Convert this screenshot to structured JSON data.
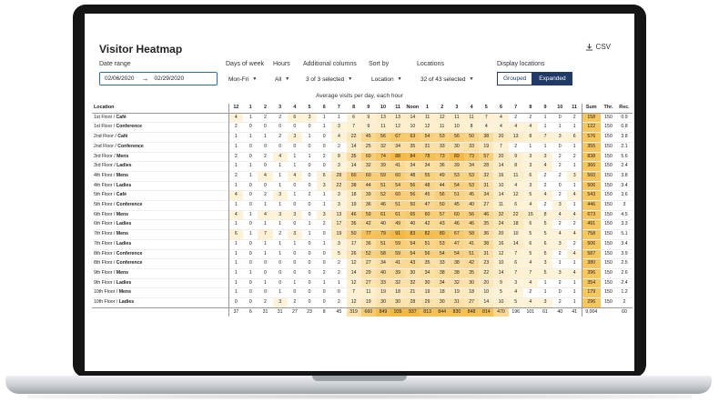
{
  "app": {
    "title": "Visitor Heatmap",
    "csv_label": "CSV"
  },
  "filters": {
    "date_range": {
      "label": "Date range",
      "start": "02/06/2020",
      "end": "02/29/2020"
    },
    "days_of_week": {
      "label": "Days of week",
      "value": "Mon-Fri"
    },
    "hours": {
      "label": "Hours",
      "value": "All"
    },
    "additional_columns": {
      "label": "Additional columns",
      "value": "3 of 3 selected"
    },
    "sort_by": {
      "label": "Sort by",
      "value": "Location"
    },
    "locations": {
      "label": "Locations",
      "value": "32 of 43 selected"
    },
    "display_locations": {
      "label": "Display locations",
      "grouped": "Grouped",
      "expanded": "Expanded",
      "active": "Expanded"
    }
  },
  "table": {
    "subtitle": "Average visits per day, each hour",
    "columns": [
      "Location",
      "12",
      "1",
      "2",
      "3",
      "4",
      "5",
      "6",
      "7",
      "8",
      "9",
      "10",
      "11",
      "Noon",
      "1",
      "2",
      "3",
      "4",
      "5",
      "6",
      "7",
      "8",
      "9",
      "10",
      "11",
      "Sum",
      "Thr.",
      "Rec."
    ],
    "rows": [
      {
        "location": "1st Floor / Café",
        "values": [
          4,
          1,
          2,
          2,
          6,
          3,
          1,
          1,
          6,
          9,
          13,
          13,
          14,
          11,
          12,
          11,
          11,
          7,
          4,
          2,
          2,
          1,
          0,
          2
        ],
        "sum": "158",
        "thr": "150",
        "rec": "0.9"
      },
      {
        "location": "1st Floor / Conference",
        "values": [
          2,
          0,
          0,
          0,
          0,
          0,
          1,
          3,
          7,
          9,
          11,
          12,
          10,
          12,
          11,
          10,
          8,
          4,
          4,
          4,
          4,
          1,
          1,
          1
        ],
        "sum": "122",
        "thr": "150",
        "rec": "0.8"
      },
      {
        "location": "2nd Floor / Café",
        "values": [
          1,
          1,
          1,
          2,
          3,
          1,
          0,
          4,
          22,
          45,
          56,
          67,
          63,
          54,
          53,
          56,
          50,
          38,
          20,
          13,
          8,
          7,
          3,
          6
        ],
        "sum": "576",
        "thr": "150",
        "rec": "3.8"
      },
      {
        "location": "2nd Floor / Conference",
        "values": [
          1,
          0,
          0,
          0,
          0,
          0,
          0,
          2,
          14,
          25,
          32,
          34,
          35,
          31,
          33,
          30,
          33,
          19,
          7,
          2,
          1,
          1,
          0,
          1
        ],
        "sum": "355",
        "thr": "150",
        "rec": "2.1"
      },
      {
        "location": "3rd Floor / Mens",
        "values": [
          2,
          0,
          2,
          4,
          1,
          1,
          2,
          8,
          35,
          60,
          74,
          88,
          84,
          78,
          73,
          89,
          73,
          57,
          20,
          9,
          3,
          3,
          2,
          2
        ],
        "sum": "838",
        "thr": "150",
        "rec": "5.6"
      },
      {
        "location": "3rd Floor / Ladies",
        "values": [
          1,
          1,
          0,
          1,
          1,
          0,
          0,
          3,
          14,
          32,
          39,
          41,
          34,
          34,
          36,
          39,
          34,
          28,
          14,
          8,
          3,
          4,
          2,
          1
        ],
        "sum": "366",
        "thr": "150",
        "rec": "2.4"
      },
      {
        "location": "4th Floor / Mens",
        "values": [
          2,
          1,
          4,
          1,
          4,
          0,
          6,
          28,
          60,
          60,
          59,
          60,
          48,
          55,
          49,
          53,
          53,
          32,
          16,
          11,
          6,
          2,
          2,
          3
        ],
        "sum": "560",
        "thr": "150",
        "rec": "3.8"
      },
      {
        "location": "4th Floor / Ladies",
        "values": [
          1,
          0,
          0,
          1,
          0,
          0,
          3,
          22,
          38,
          44,
          51,
          54,
          56,
          48,
          44,
          54,
          53,
          31,
          10,
          4,
          3,
          2,
          0,
          1
        ],
        "sum": "506",
        "thr": "150",
        "rec": "3.4"
      },
      {
        "location": "5th Floor / Café",
        "values": [
          4,
          0,
          2,
          3,
          1,
          2,
          1,
          3,
          18,
          39,
          52,
          60,
          56,
          45,
          56,
          51,
          45,
          34,
          14,
          12,
          5,
          4,
          2,
          4
        ],
        "sum": "543",
        "thr": "150",
        "rec": "3.6"
      },
      {
        "location": "5th Floor / Conference",
        "values": [
          1,
          0,
          1,
          1,
          0,
          0,
          1,
          3,
          19,
          36,
          46,
          51,
          50,
          47,
          50,
          45,
          40,
          27,
          11,
          6,
          4,
          2,
          3,
          1
        ],
        "sum": "446",
        "thr": "150",
        "rec": "3"
      },
      {
        "location": "6th Floor / Mens",
        "values": [
          4,
          1,
          4,
          3,
          3,
          0,
          3,
          13,
          46,
          59,
          61,
          61,
          65,
          60,
          57,
          60,
          56,
          46,
          32,
          22,
          15,
          8,
          4,
          4
        ],
        "sum": "673",
        "thr": "150",
        "rec": "4.5"
      },
      {
        "location": "6th Floor / Ladies",
        "values": [
          1,
          0,
          1,
          1,
          0,
          1,
          2,
          17,
          36,
          42,
          40,
          49,
          40,
          42,
          43,
          46,
          46,
          35,
          24,
          18,
          6,
          5,
          2,
          2
        ],
        "sum": "491",
        "thr": "150",
        "rec": "3.3"
      },
      {
        "location": "7th Floor / Mens",
        "values": [
          6,
          1,
          7,
          2,
          3,
          1,
          0,
          19,
          50,
          77,
          79,
          91,
          83,
          82,
          80,
          67,
          58,
          36,
          20,
          10,
          5,
          5,
          4,
          4
        ],
        "sum": "758",
        "thr": "150",
        "rec": "5.1"
      },
      {
        "location": "7th Floor / Ladies",
        "values": [
          1,
          0,
          1,
          1,
          1,
          0,
          1,
          3,
          17,
          36,
          51,
          59,
          54,
          51,
          53,
          47,
          41,
          38,
          16,
          14,
          6,
          6,
          3,
          2
        ],
        "sum": "506",
        "thr": "150",
        "rec": "3.4"
      },
      {
        "location": "8th Floor / Conference",
        "values": [
          1,
          0,
          1,
          1,
          0,
          0,
          0,
          5,
          26,
          52,
          58,
          59,
          54,
          56,
          54,
          54,
          51,
          31,
          12,
          7,
          5,
          5,
          2,
          4
        ],
        "sum": "587",
        "thr": "150",
        "rec": "3.9"
      },
      {
        "location": "8th Floor / Conference",
        "values": [
          1,
          0,
          0,
          0,
          0,
          0,
          0,
          2,
          12,
          27,
          34,
          41,
          43,
          35,
          33,
          38,
          42,
          23,
          10,
          6,
          4,
          3,
          1,
          1
        ],
        "sum": "380",
        "thr": "150",
        "rec": "2.5"
      },
      {
        "location": "9th Floor / Mens",
        "values": [
          1,
          1,
          0,
          0,
          0,
          0,
          2,
          2,
          14,
          29,
          40,
          39,
          30,
          34,
          38,
          38,
          35,
          22,
          14,
          7,
          7,
          5,
          3,
          4
        ],
        "sum": "396",
        "thr": "150",
        "rec": "2.6"
      },
      {
        "location": "9th Floor / Ladies",
        "values": [
          1,
          0,
          1,
          0,
          1,
          0,
          1,
          1,
          12,
          27,
          33,
          32,
          32,
          30,
          34,
          32,
          30,
          20,
          9,
          3,
          4,
          1,
          2,
          1
        ],
        "sum": "354",
        "thr": "150",
        "rec": "2.4"
      },
      {
        "location": "10th Floor / Mens",
        "values": [
          1,
          0,
          0,
          1,
          0,
          0,
          0,
          0,
          7,
          11,
          19,
          18,
          21,
          19,
          18,
          19,
          18,
          10,
          5,
          4,
          2,
          1,
          0,
          1
        ],
        "sum": "179",
        "thr": "150",
        "rec": "1.2"
      },
      {
        "location": "10th Floor / Ladies",
        "values": [
          0,
          0,
          2,
          3,
          2,
          0,
          0,
          2,
          12,
          19,
          30,
          30,
          28,
          29,
          30,
          31,
          27,
          14,
          10,
          5,
          4,
          3,
          2,
          1
        ],
        "sum": "296",
        "thr": "150",
        "rec": "2"
      }
    ],
    "footer": {
      "values": [
        37,
        6,
        31,
        31,
        27,
        23,
        8,
        45,
        319,
        660,
        849,
        935,
        937,
        813,
        844,
        830,
        848,
        814,
        470,
        196,
        101,
        61,
        40,
        41
      ],
      "sum": "9,004",
      "thr": "",
      "rec": "60"
    }
  },
  "colors": {
    "heat_high": "#f4b942",
    "heat_low": "#fff3d1",
    "accent": "#1f3a66",
    "date_border": "#2b6cb0"
  }
}
